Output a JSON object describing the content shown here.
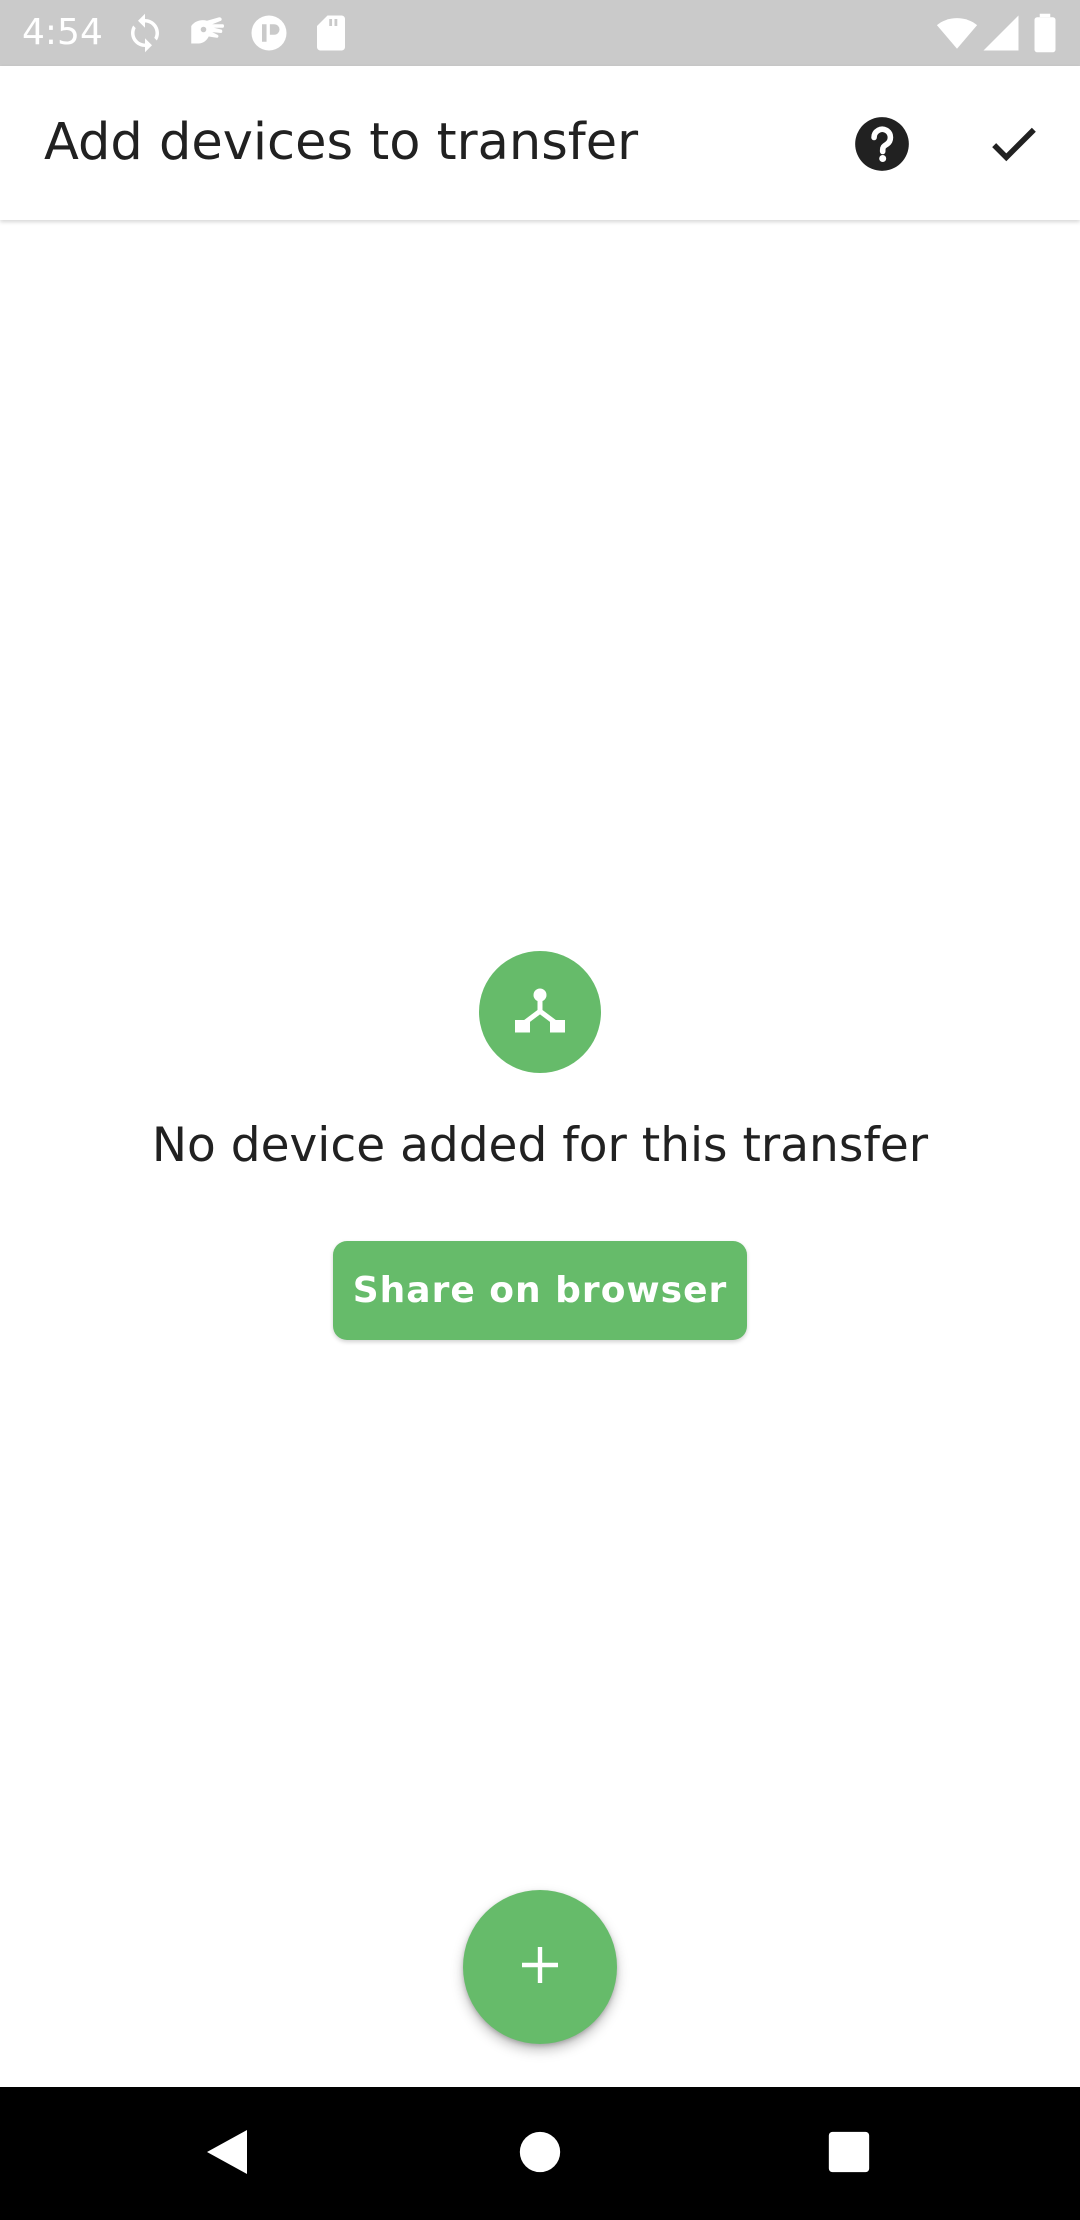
{
  "status_bar": {
    "time": "4:54",
    "left_icons": [
      "sync-icon",
      "hand-icon",
      "app-icon",
      "sd-card-icon"
    ],
    "right_icons": [
      "wifi-icon",
      "cellular-icon",
      "battery-icon"
    ]
  },
  "app_bar": {
    "title": "Add devices to transfer",
    "actions": [
      "help-icon",
      "check-icon"
    ]
  },
  "empty_state": {
    "icon": "device-network-icon",
    "message": "No device added for this transfer",
    "button_label": "Share on browser"
  },
  "fab": {
    "icon": "plus-icon"
  },
  "nav_bar": {
    "buttons": [
      "back-icon",
      "home-icon",
      "recents-icon"
    ]
  },
  "colors": {
    "accent": "#66bb6a",
    "status_bar": "#cacaca",
    "text_primary": "#212121",
    "nav_bar": "#000000"
  }
}
